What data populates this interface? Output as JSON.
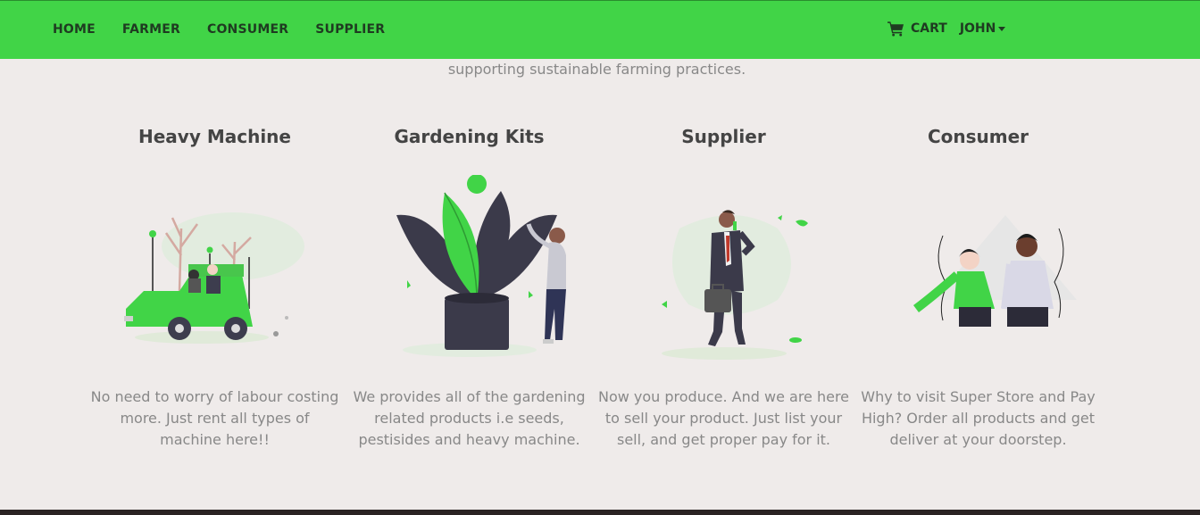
{
  "nav": {
    "links": [
      "HOME",
      "FARMER",
      "CONSUMER",
      "SUPPLIER"
    ],
    "cart_label": "CART",
    "user_label": "JOHN"
  },
  "intro_text": "supporting sustainable farming practices.",
  "cards": [
    {
      "title": "Heavy Machine",
      "description": "No need to worry of labour costing more. Just rent all types of machine here!!"
    },
    {
      "title": "Gardening Kits",
      "description": "We provides all of the gardening related products i.e seeds, pestisides and heavy machine."
    },
    {
      "title": "Supplier",
      "description": "Now you produce. And we are here to sell your product. Just list your sell, and get proper pay for it."
    },
    {
      "title": "Consumer",
      "description": "Why to visit Super Store and Pay High? Order all products and get deliver at your doorstep."
    }
  ],
  "colors": {
    "brand_green": "#41d447",
    "background": "#efebea",
    "text_dark": "#1f3b21"
  },
  "icons": {
    "cart": "shopping-cart-icon",
    "user_menu": "caret-down-icon"
  }
}
